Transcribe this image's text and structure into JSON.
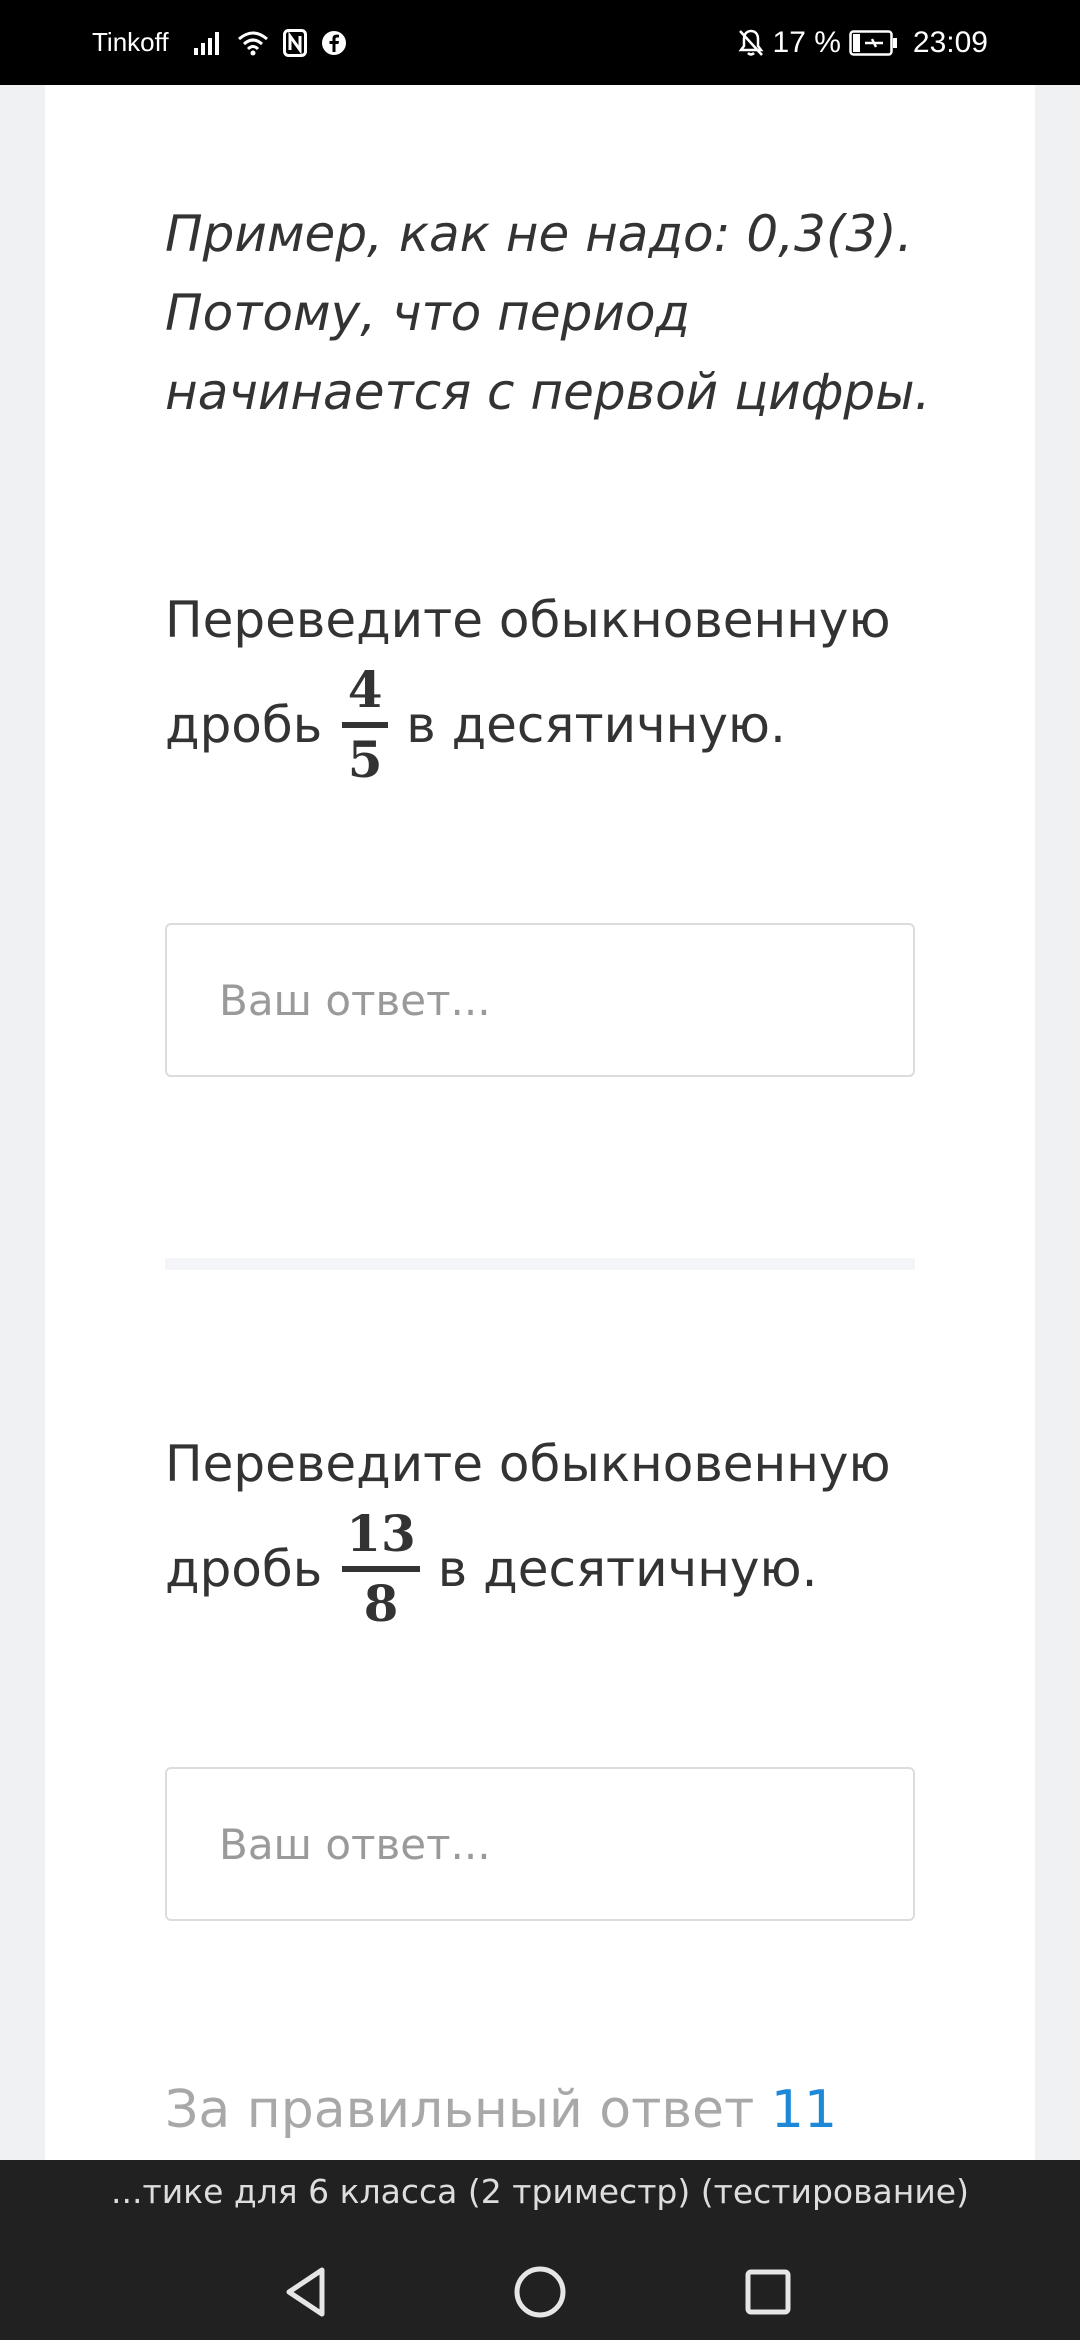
{
  "status_bar": {
    "carrier": "Tinkoff",
    "battery": "17 %",
    "time": "23:09",
    "icons": [
      "signal-icon",
      "wifi-icon",
      "nfc-icon",
      "facebook-icon",
      "mute-icon",
      "battery-icon"
    ]
  },
  "note": {
    "text": "Пример, как не надо: 0,3(3). Потому, что период начинается с первой цифры."
  },
  "questions": [
    {
      "line1": "Переведите обыкновенную",
      "prefix": "дробь",
      "numerator": "4",
      "denominator": "5",
      "suffix": "в десятичную.",
      "placeholder": "Ваш ответ..."
    },
    {
      "line1": "Переведите обыкновенную",
      "prefix": "дробь",
      "numerator": "13",
      "denominator": "8",
      "suffix": "в десятичную.",
      "placeholder": "Ваш ответ..."
    }
  ],
  "points": {
    "label": "За правильный ответ",
    "value": "11"
  },
  "bottom_bar": {
    "page_title": "...тике для 6 класса (2 триместр) (тестирование)",
    "nav": [
      "back-icon",
      "home-icon",
      "recents-icon"
    ]
  },
  "colors": {
    "accent": "#1e88d8",
    "text": "#333333",
    "muted": "#a8a8a8"
  }
}
